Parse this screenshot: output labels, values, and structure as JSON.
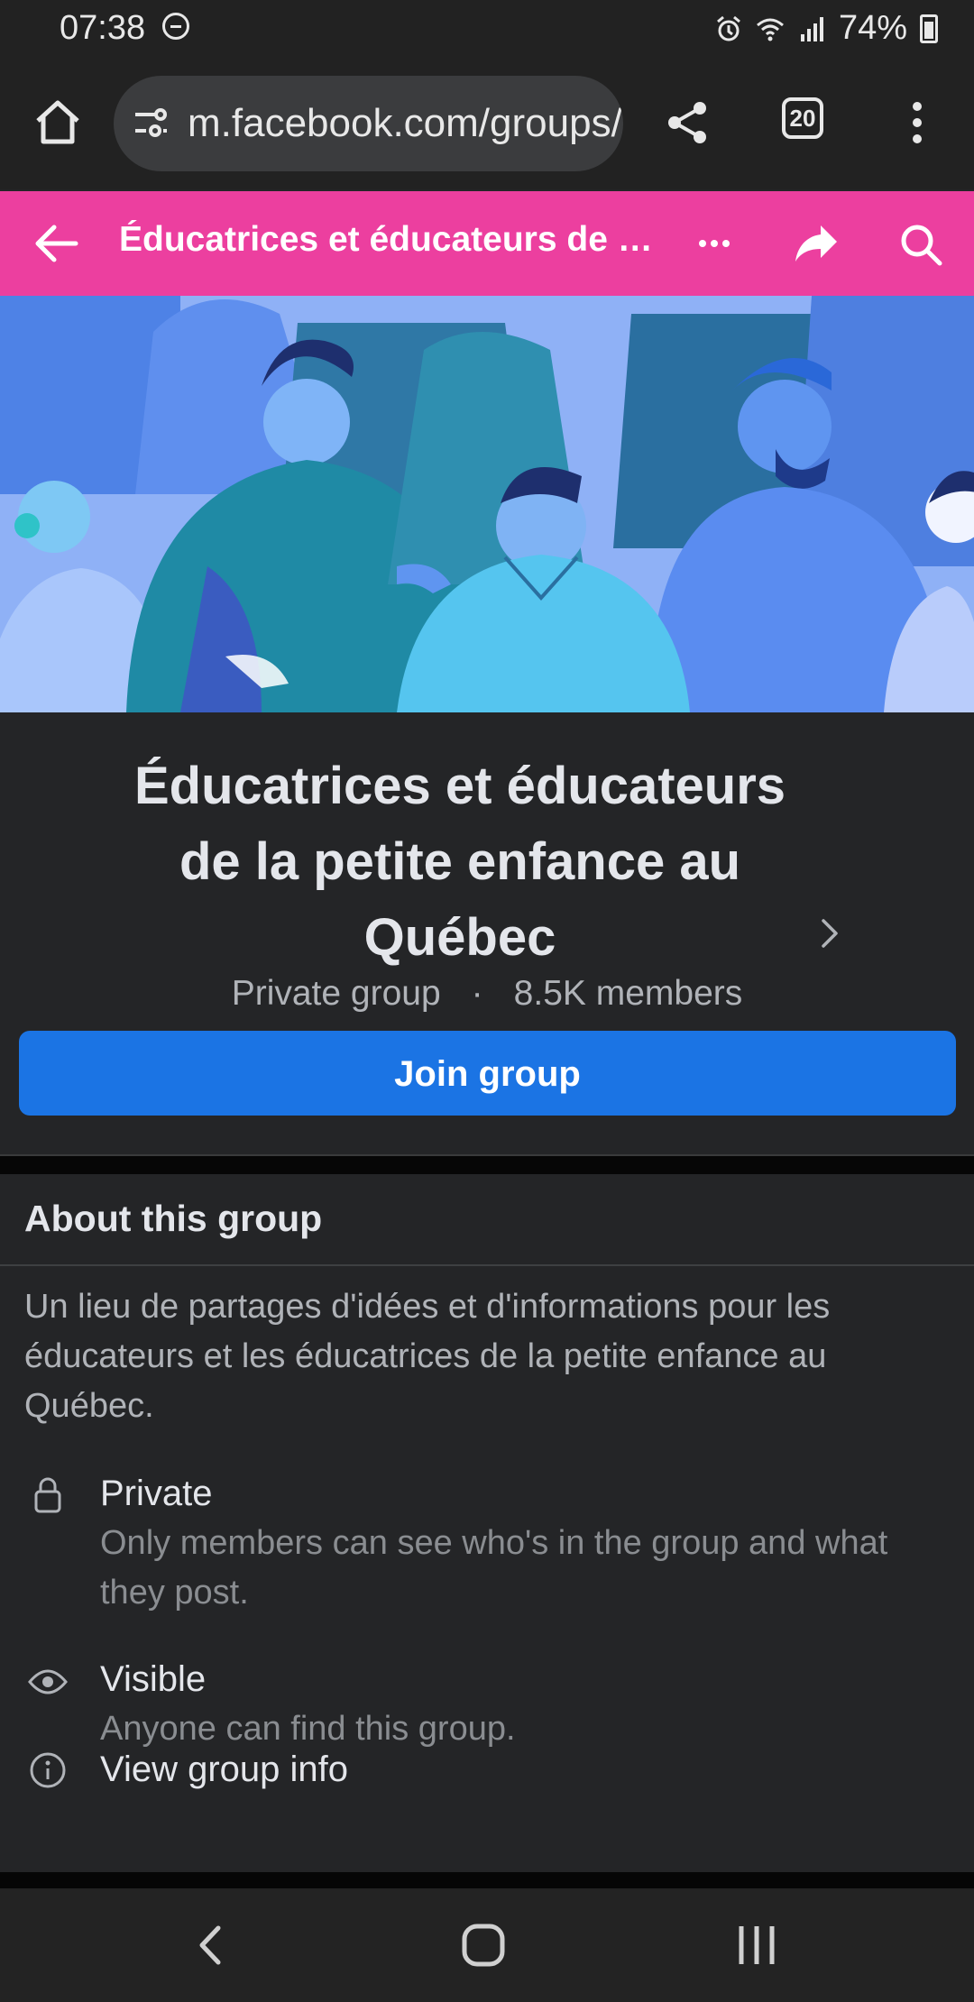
{
  "status_bar": {
    "time": "07:38",
    "battery": "74%"
  },
  "browser": {
    "url": "m.facebook.com/groups/",
    "tab_count": "20",
    "icons": [
      "home-icon",
      "site-info-icon",
      "share-icon",
      "tabs-icon",
      "more-icon"
    ]
  },
  "group_header": {
    "title": "Éducatrices et éducateurs de la petite enfance au Québec",
    "icons": [
      "back-arrow-icon",
      "more-icon",
      "share-icon",
      "search-icon"
    ],
    "color": "#ec3f9f"
  },
  "group": {
    "name": "Éducatrices et éducateurs de la petite enfance au Québec",
    "privacy": "Private group",
    "separator": "·",
    "members": "8.5K members",
    "join_label": "Join group"
  },
  "about": {
    "heading": "About this group",
    "description": "Un lieu de partages d'idées et d'informations pour les éducateurs et les éducatrices de la petite enfance au Québec.",
    "items": [
      {
        "icon": "lock-icon",
        "title": "Private",
        "subtitle": "Only members can see who's in the group and what they post."
      },
      {
        "icon": "eye-icon",
        "title": "Visible",
        "subtitle": "Anyone can find this group."
      },
      {
        "icon": "info-icon",
        "title": "View group info"
      }
    ]
  },
  "nav": {
    "icons": [
      "back-nav-icon",
      "home-nav-icon",
      "recents-nav-icon"
    ]
  },
  "colors": {
    "accent": "#1b74e4",
    "background": "#242527"
  }
}
